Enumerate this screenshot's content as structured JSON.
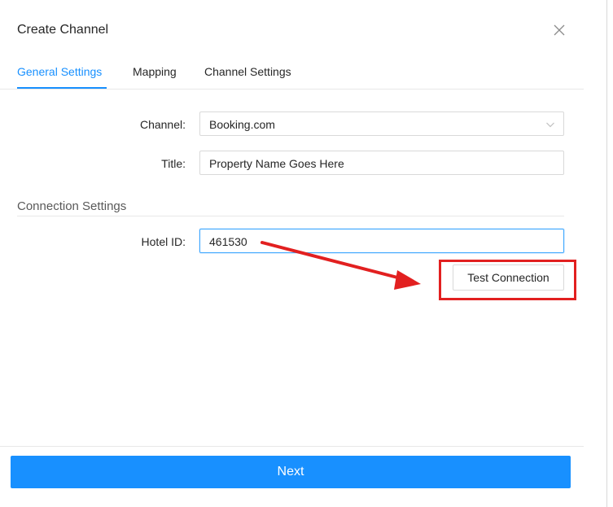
{
  "dialog": {
    "title": "Create Channel"
  },
  "tabs": [
    {
      "label": "General Settings",
      "active": true
    },
    {
      "label": "Mapping",
      "active": false
    },
    {
      "label": "Channel Settings",
      "active": false
    }
  ],
  "form": {
    "channel": {
      "label": "Channel",
      "value": "Booking.com"
    },
    "title": {
      "label": "Title",
      "value": "Property Name Goes Here"
    }
  },
  "connection": {
    "section_title": "Connection Settings",
    "hotel_id": {
      "label": "Hotel ID",
      "value": "461530"
    },
    "test_button": "Test Connection"
  },
  "footer": {
    "next_label": "Next"
  },
  "colors": {
    "accent": "#1890ff",
    "annotation": "#e22020"
  },
  "icons": {
    "close": "close-icon",
    "dropdown": "chevron-down-icon"
  }
}
